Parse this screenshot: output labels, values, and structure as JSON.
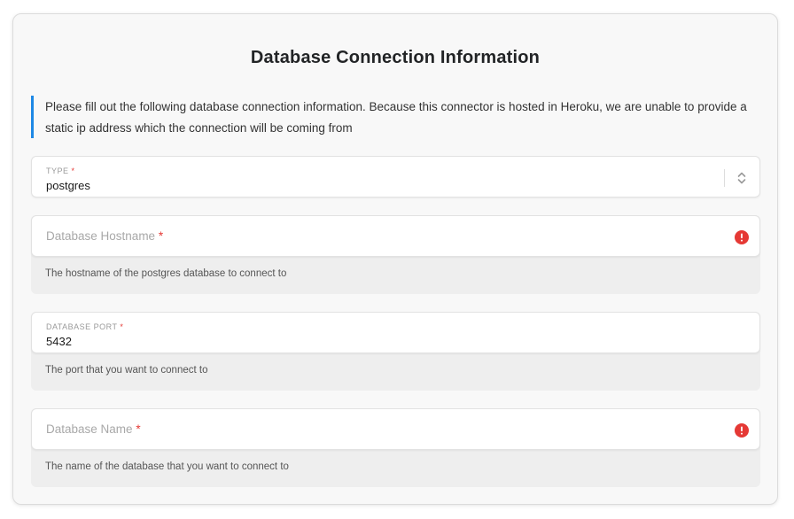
{
  "form": {
    "title": "Database Connection Information",
    "notice": "Please fill out the following database connection information. Because this connector is hosted in Heroku, we are unable to provide a static ip address which the connection will be coming from",
    "fields": {
      "type": {
        "label": "TYPE",
        "required_mark": "*",
        "value": "postgres"
      },
      "hostname": {
        "placeholder": "Database Hostname",
        "required_mark": "*",
        "help": "The hostname of the postgres database to connect to",
        "error_icon": "alert-circle-icon"
      },
      "port": {
        "label": "DATABASE PORT",
        "required_mark": "*",
        "value": "5432",
        "help": "The port that you want to connect to"
      },
      "name": {
        "placeholder": "Database Name",
        "required_mark": "*",
        "help": "The name of the database that you want to connect to",
        "error_icon": "alert-circle-icon"
      }
    }
  },
  "colors": {
    "accent": "#1e88e5",
    "error": "#e53935",
    "card_background": "#f8f8f8",
    "help_background": "#eeeeee"
  }
}
